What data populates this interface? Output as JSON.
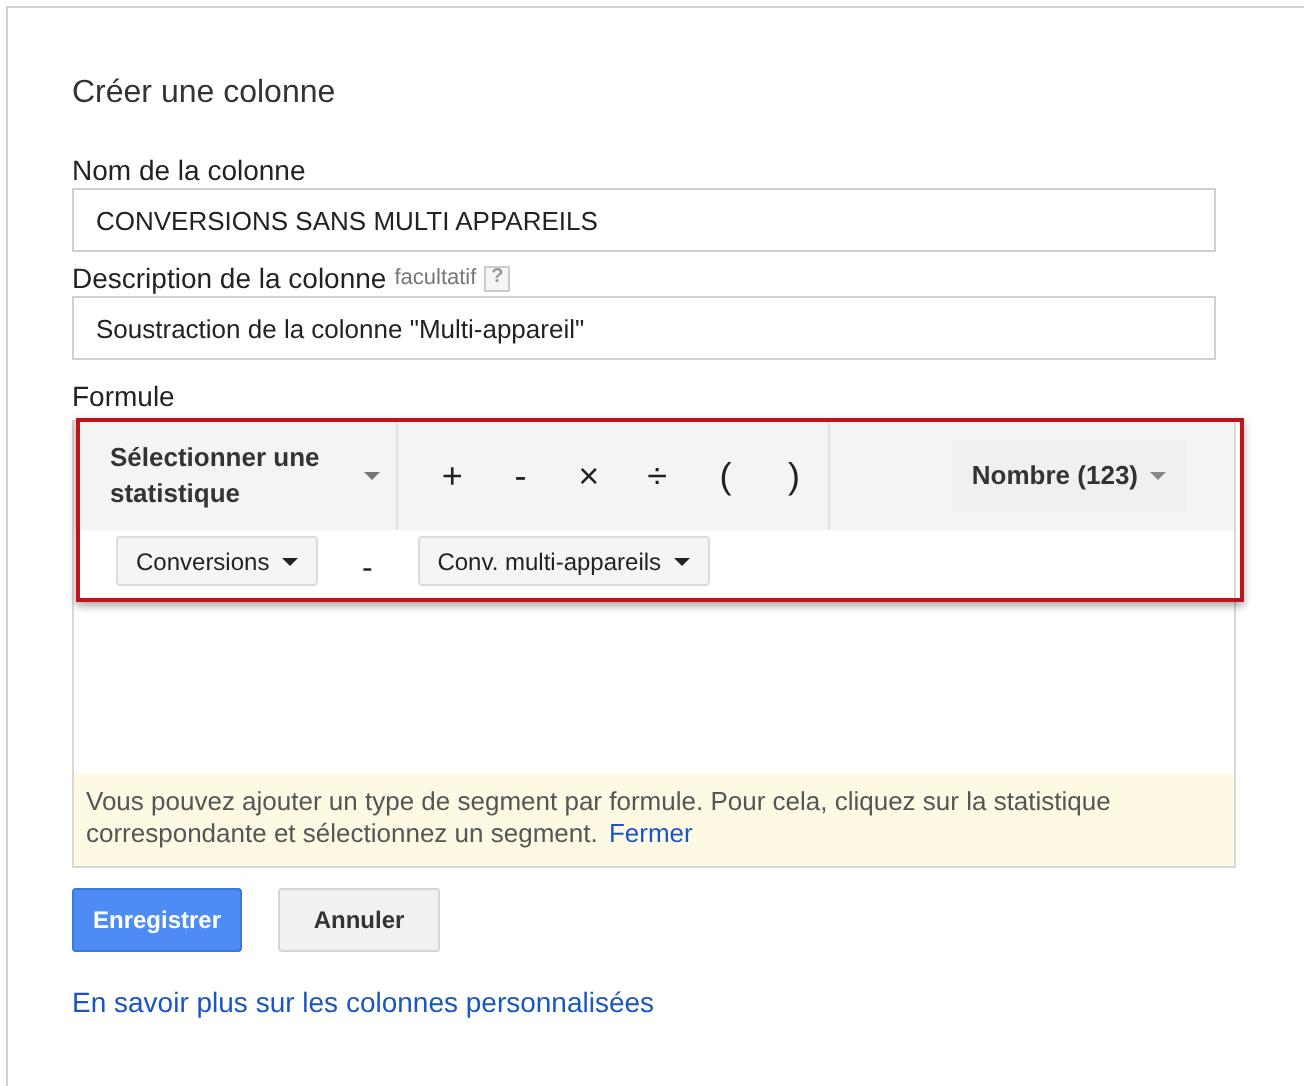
{
  "dialog": {
    "title": "Créer une colonne"
  },
  "name_field": {
    "label": "Nom de la colonne",
    "value": "CONVERSIONS SANS MULTI APPAREILS"
  },
  "description_field": {
    "label": "Description de la colonne",
    "hint": "facultatif",
    "help": "?",
    "value": "Soustraction de la colonne \"Multi-appareil\""
  },
  "formula": {
    "label": "Formule",
    "toolbar": {
      "statistic_select": "Sélectionner une statistique",
      "operators": [
        "+",
        "-",
        "×",
        "÷",
        "(",
        ")"
      ],
      "number_select": "Nombre (123)"
    },
    "tokens": [
      {
        "kind": "metric",
        "label": "Conversions"
      },
      {
        "kind": "operator",
        "label": "-"
      },
      {
        "kind": "metric",
        "label": "Conv. multi-appareils"
      }
    ],
    "note": {
      "text": "Vous pouvez ajouter un type de segment par formule. Pour cela, cliquez sur la statistique correspondante et sélectionnez un segment.",
      "link": "Fermer"
    }
  },
  "buttons": [
    {
      "kind": "primary",
      "label": "Enregistrer"
    },
    {
      "kind": "secondary",
      "label": "Annuler"
    }
  ],
  "footer_link": "En savoir plus sur les colonnes personnalisées"
}
